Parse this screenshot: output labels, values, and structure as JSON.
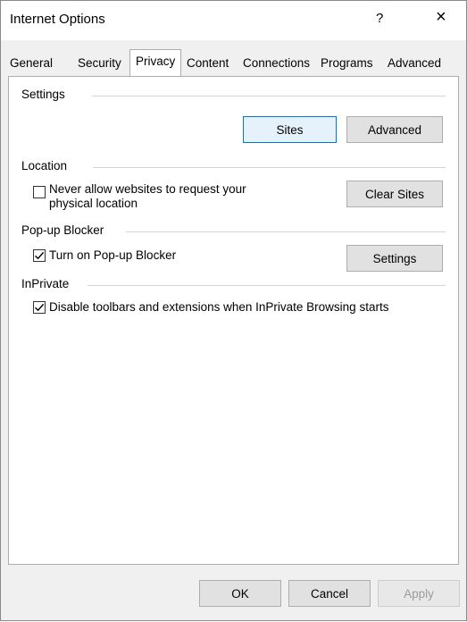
{
  "window": {
    "title": "Internet Options",
    "help": "?",
    "close": "×"
  },
  "tabs": [
    {
      "label": "General"
    },
    {
      "label": "Security"
    },
    {
      "label": "Privacy",
      "active": true
    },
    {
      "label": "Content"
    },
    {
      "label": "Connections"
    },
    {
      "label": "Programs"
    },
    {
      "label": "Advanced"
    }
  ],
  "settings": {
    "header": "Settings",
    "sites_button": "Sites",
    "advanced_button": "Advanced"
  },
  "location": {
    "header": "Location",
    "checkbox_line1": "Never allow websites to request your",
    "checkbox_line2": "physical location",
    "checked": false,
    "clear_sites_button": "Clear Sites"
  },
  "popup": {
    "header": "Pop-up Blocker",
    "checkbox_label": "Turn on Pop-up Blocker",
    "checked": true,
    "settings_button": "Settings"
  },
  "inprivate": {
    "header": "InPrivate",
    "checkbox_label": "Disable toolbars and extensions when InPrivate Browsing starts",
    "checked": true
  },
  "footer": {
    "ok": "OK",
    "cancel": "Cancel",
    "apply": "Apply"
  }
}
